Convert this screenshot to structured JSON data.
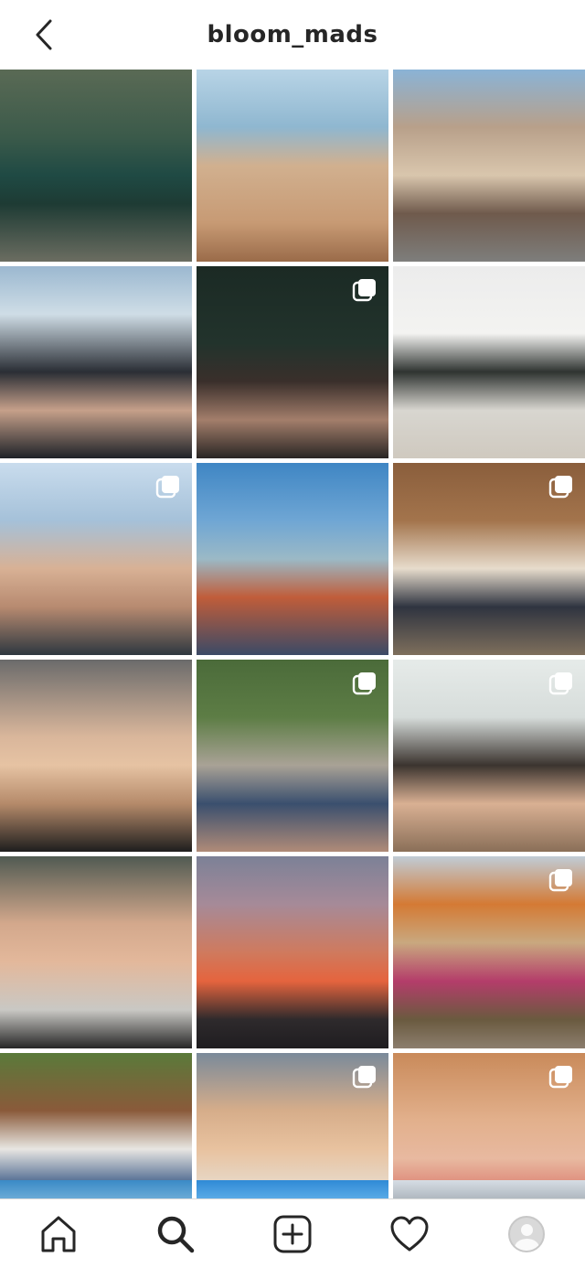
{
  "header": {
    "title": "bloom_mads",
    "back_icon": "chevron-left-icon"
  },
  "grid": {
    "tiles": [
      {
        "name": "post-waterfall-swim",
        "multi": false,
        "bg": "linear-gradient(180deg,#5a6a55 0%,#3b5a4a 35%,#1f4a44 55%,#1e3b34 70%,#6b6d61 100%)"
      },
      {
        "name": "post-beach-friends",
        "multi": false,
        "bg": "linear-gradient(180deg,#b8d4e6 0%,#8fb7d0 30%,#d1b08f 50%,#c79a74 80%,#9a6b49 100%)"
      },
      {
        "name": "post-street-sunny",
        "multi": false,
        "bg": "linear-gradient(180deg,#8ab3d6 0%,#b8a08a 30%,#d9c6ad 55%,#6f5a4c 75%,#7e7e7c 100%)"
      },
      {
        "name": "post-winter-couple",
        "multi": false,
        "bg": "linear-gradient(180deg,#9bb8d0 0%,#cfdde6 25%,#2a2e35 55%,#c6a08a 75%,#1e2228 100%)"
      },
      {
        "name": "post-night-friends",
        "multi": true,
        "bg": "linear-gradient(180deg,#1b2a24 0%,#22332c 40%,#3a2f2b 60%,#a37e6b 80%,#2a2624 100%)"
      },
      {
        "name": "post-coffee-shop",
        "multi": false,
        "bg": "linear-gradient(180deg,#ececec 0%,#f3f3f1 35%,#2f3431 55%,#d8d6d0 75%,#cfc9bf 100%)"
      },
      {
        "name": "post-beach-selfie",
        "multi": true,
        "bg": "linear-gradient(180deg,#c9dced 0%,#a5c1d9 30%,#d8b195 55%,#b78a70 75%,#2e3840 100%)"
      },
      {
        "name": "post-lake-swimsuit",
        "multi": false,
        "bg": "linear-gradient(180deg,#3f86c4 0%,#6fa6d4 30%,#9bb9c6 50%,#c05d3a 70%,#3b4a66 100%)"
      },
      {
        "name": "post-family-walk",
        "multi": true,
        "bg": "linear-gradient(180deg,#8a5e3c 0%,#a3744c 30%,#e7dccc 55%,#2f3440 75%,#7e6f5c 100%)"
      },
      {
        "name": "post-car-selfie",
        "multi": false,
        "bg": "linear-gradient(180deg,#6b6b6b 0%,#d9b69b 40%,#e6c3a3 55%,#b58a6a 75%,#1e1e1e 100%)"
      },
      {
        "name": "post-backyard-hug",
        "multi": true,
        "bg": "linear-gradient(180deg,#4b6b3a 0%,#5d7d45 30%,#a9a296 55%,#3a4f6e 75%,#b08b78 100%)"
      },
      {
        "name": "post-closeup-pet",
        "multi": true,
        "bg": "linear-gradient(180deg,#e6ebe9 0%,#d6dcda 30%,#3b342f 55%,#d9b093 75%,#8a6f58 100%)"
      },
      {
        "name": "post-couple-selfie",
        "multi": false,
        "bg": "linear-gradient(180deg,#505a52 0%,#d3a88c 35%,#e3b89b 55%,#c9c8c4 80%,#262626 100%)"
      },
      {
        "name": "post-sunset-sky",
        "multi": false,
        "bg": "linear-gradient(180deg,#7c8197 0%,#a68a98 25%,#cf7a5e 50%,#e5643e 65%,#2e2a2c 85%,#1f1d20 100%)"
      },
      {
        "name": "post-family-outdoor",
        "multi": true,
        "bg": "linear-gradient(180deg,#c0ccd6 0%,#d47a34 25%,#c9a87f 45%,#b43d6a 65%,#6a5a3f 85%,#8c7e6e 100%)"
      },
      {
        "name": "post-garden-couple",
        "multi": false,
        "bg": "linear-gradient(180deg,#5a7a3a 0%,#8a5a3a 30%,#e8e6e2 50%,#3b5a86 70%,#4a3a2e 100%)"
      },
      {
        "name": "post-friends-selfie",
        "multi": true,
        "bg": "linear-gradient(180deg,#7a8a9a 0%,#d6ad8a 30%,#e8c29f 50%,#e6e0d6 75%,#3a2e26 100%)"
      },
      {
        "name": "post-smile-closeup",
        "multi": true,
        "bg": "linear-gradient(180deg,#c98a5a 0%,#e2b08c 35%,#e8b9a0 55%,#d9766a 75%,#a8785c 100%)"
      }
    ],
    "partial_row": [
      {
        "name": "post-partial-1",
        "bg": "linear-gradient(180deg,#3a8ac6 0%,#6aaad6 100%)"
      },
      {
        "name": "post-partial-2",
        "bg": "linear-gradient(180deg,#2f8ad6 0%,#5aaae6 100%)"
      },
      {
        "name": "post-partial-3",
        "bg": "linear-gradient(180deg,#d6dde4 0%,#b0b8c0 100%)"
      }
    ]
  },
  "navbar": {
    "items": [
      "home-icon",
      "search-icon",
      "new-post-icon",
      "heart-icon",
      "profile-avatar"
    ]
  },
  "colors": {
    "text": "#262626",
    "divider": "#dbdbdb",
    "background": "#ffffff"
  }
}
